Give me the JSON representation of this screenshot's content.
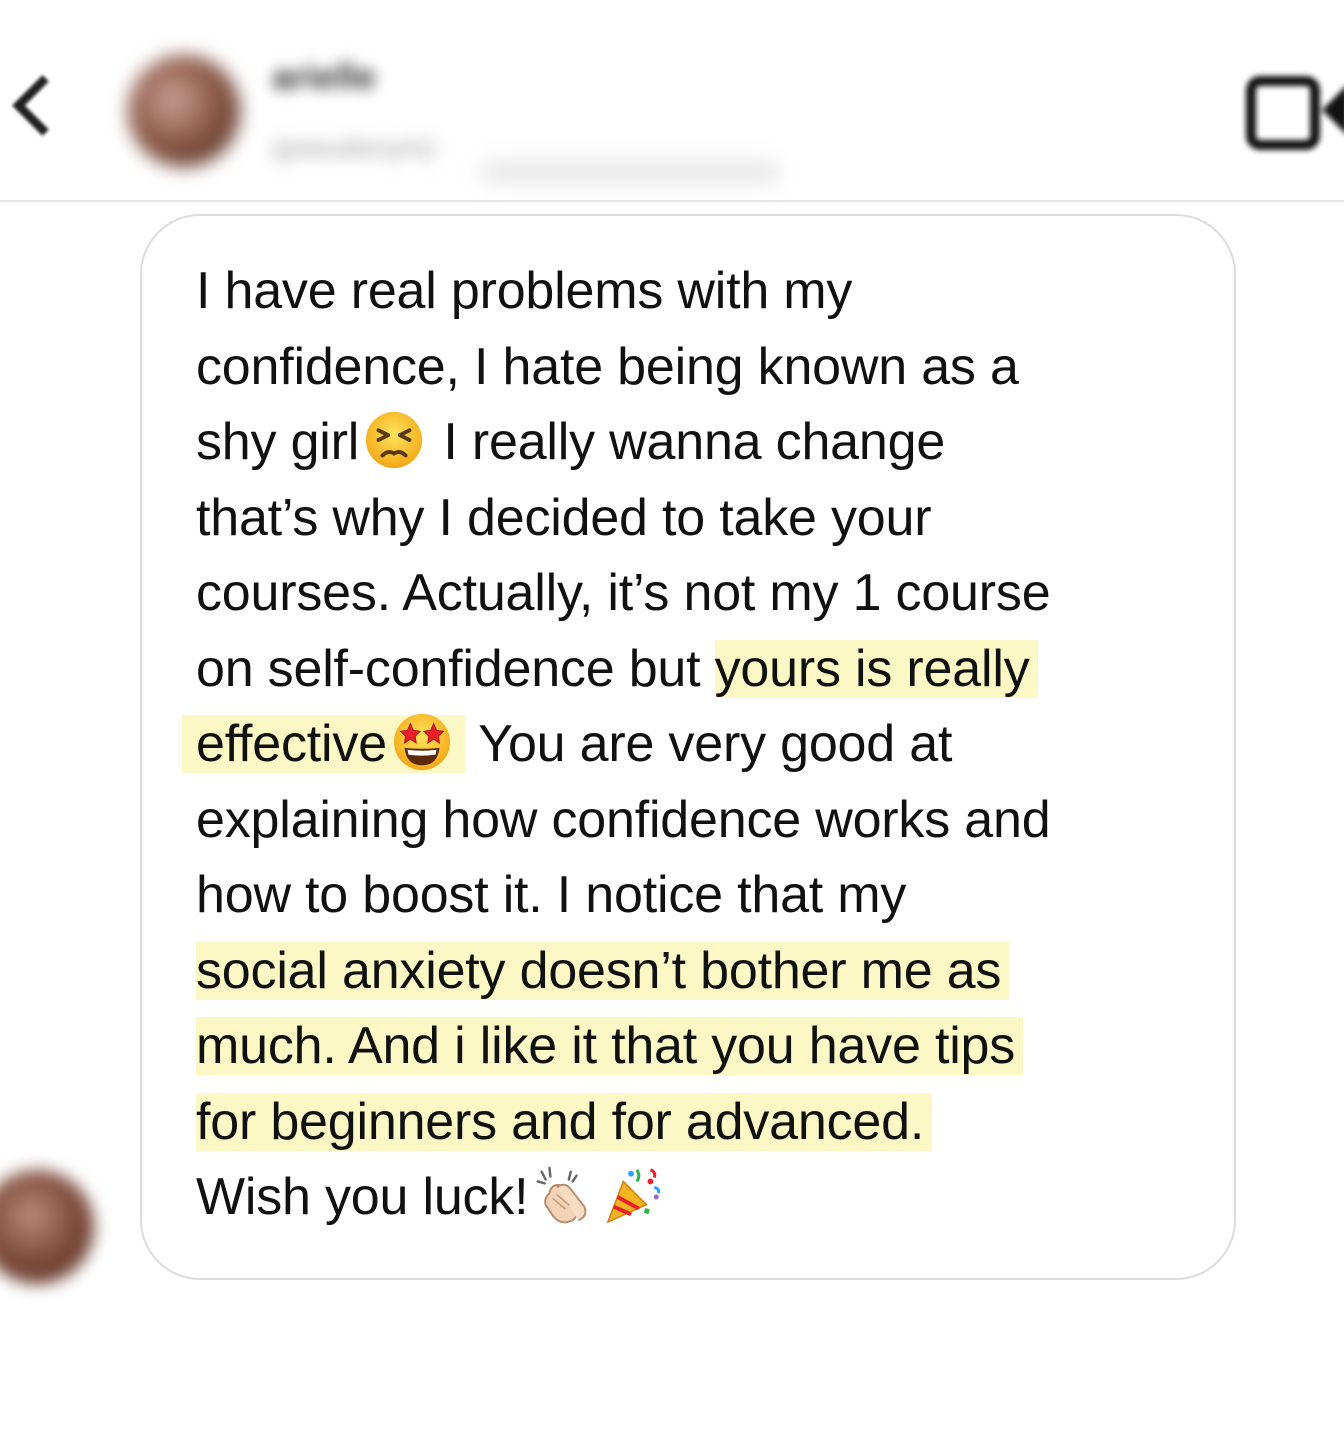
{
  "header": {
    "contact_name": "arielle",
    "contact_status": "(pseudonym)",
    "colors": {
      "divider": "#e6e6e6",
      "icon": "#111111"
    }
  },
  "message": {
    "bubble_border": "#dcdcdc",
    "highlight_color": "#fbf8c6",
    "lines": [
      "I have real problems with my",
      "confidence, I hate being known as a",
      "shy girl",
      " I really wanna change",
      "that’s why I decided to take your",
      "courses. Actually, it’s not my 1 course",
      "on self-confidence but ",
      "yours is really",
      "effective",
      " You are very good at",
      "explaining how confidence works and",
      "how to boost it. I notice that my",
      "social anxiety doesn’t bother me as",
      "much. And i like it that you have tips",
      "for beginners and for advanced.",
      "Wish you luck!"
    ],
    "emojis": {
      "persevering_face": "persevering-face-emoji",
      "star_struck": "star-struck-emoji",
      "clapping_hands": "clapping-hands-emoji",
      "party_popper": "party-popper-emoji"
    }
  }
}
